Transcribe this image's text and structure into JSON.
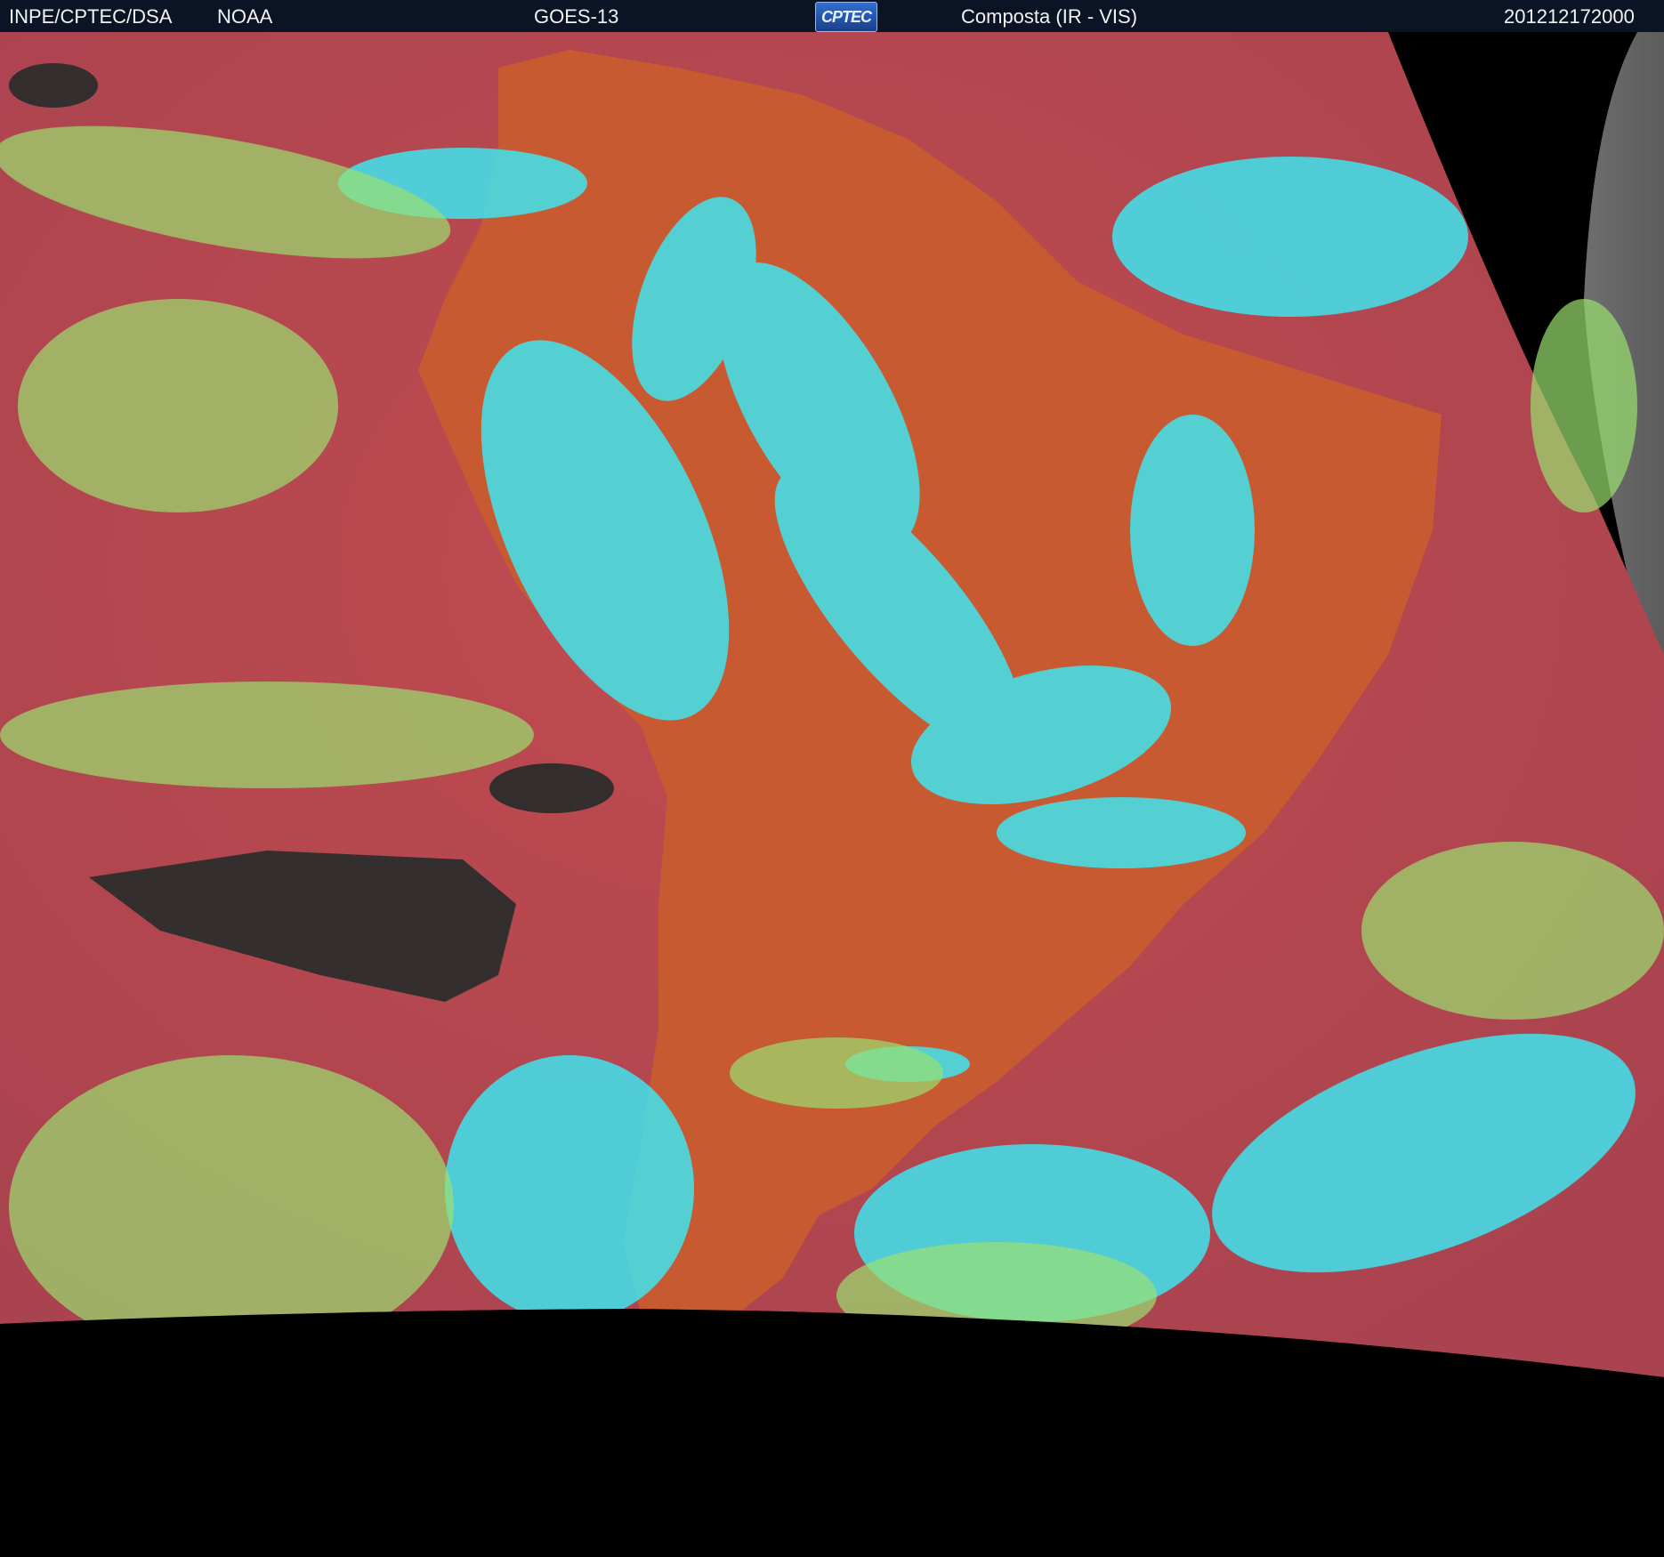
{
  "header": {
    "agency": "INPE/CPTEC/DSA",
    "source": "NOAA",
    "satellite": "GOES-13",
    "logo_text": "CPTEC",
    "product": "Composta (IR - VIS)",
    "timestamp": "201212172000"
  },
  "colors": {
    "header_bg": "#0b1424",
    "ocean_red": "#b2454e",
    "land_orange": "#c85a32",
    "cloud_cyan": "#3fe6f0",
    "cloud_green": "#9be070",
    "clear_dark": "#2d2d2d",
    "disk_gray": "#8a8a8a",
    "space": "#000000",
    "borders": "#1a1a1a"
  }
}
